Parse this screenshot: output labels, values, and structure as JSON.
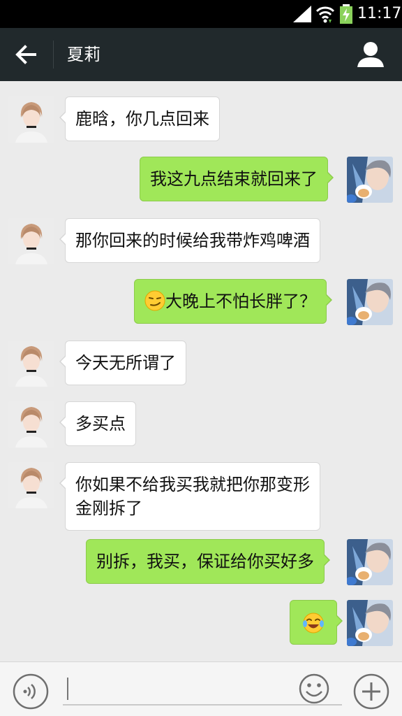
{
  "status_bar": {
    "time": "11:17",
    "icons": [
      "signal-icon",
      "wifi-icon",
      "battery-charging-icon"
    ]
  },
  "header": {
    "title": "夏莉",
    "back_icon": "back-arrow-icon",
    "profile_icon": "person-icon"
  },
  "messages": [
    {
      "sender": "friend",
      "text": "鹿晗，你几点回来"
    },
    {
      "sender": "me",
      "text": "我这九点结束就回来了"
    },
    {
      "sender": "friend",
      "text": "那你回来的时候给我带炸鸡啤酒"
    },
    {
      "sender": "me",
      "emoji": "smirk-emoji",
      "text": "大晚上不怕长胖了？"
    },
    {
      "sender": "friend",
      "text": "今天无所谓了"
    },
    {
      "sender": "friend",
      "text": "多买点"
    },
    {
      "sender": "friend",
      "line1": "你如果不给我买我就把你那变形",
      "line2": "金刚拆了"
    },
    {
      "sender": "me",
      "text": "别拆，我买，保证给你买好多"
    },
    {
      "sender": "me",
      "emoji": "tears-of-joy-emoji"
    }
  ],
  "input_bar": {
    "voice_icon": "voice-icon",
    "sticker_icon": "smiley-icon",
    "plus_icon": "plus-icon",
    "value": "",
    "placeholder": ""
  },
  "colors": {
    "header_bg": "#21292c",
    "chat_bg": "#ebebeb",
    "my_bubble": "#a0e759",
    "friend_bubble": "#ffffff"
  }
}
